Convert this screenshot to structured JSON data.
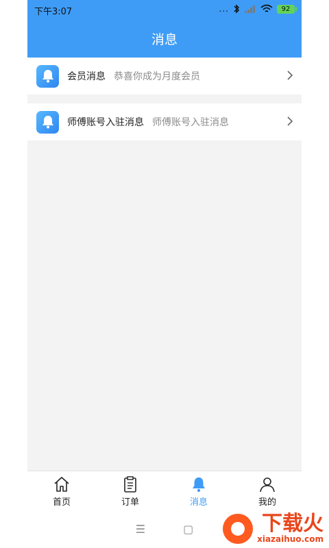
{
  "status_bar": {
    "time": "下午3:07",
    "dots": "...",
    "battery": "92"
  },
  "header": {
    "title": "消息"
  },
  "messages": [
    {
      "title": "会员消息",
      "desc": "恭喜你成为月度会员"
    },
    {
      "title": "师傅账号入驻消息",
      "desc": "师傅账号入驻消息"
    }
  ],
  "tabs": [
    {
      "label": "首页",
      "icon": "home-icon"
    },
    {
      "label": "订单",
      "icon": "clipboard-icon"
    },
    {
      "label": "消息",
      "icon": "bell-icon"
    },
    {
      "label": "我的",
      "icon": "user-icon"
    }
  ],
  "system_nav": {
    "menu": "☰",
    "home": "▢"
  },
  "watermark": {
    "cn": "下载火",
    "en": "xiazaihuo.com"
  },
  "colors": {
    "accent": "#3f9cf6",
    "background": "#f3f3f3",
    "text_primary": "#222222",
    "text_secondary": "#8b8b8b"
  }
}
